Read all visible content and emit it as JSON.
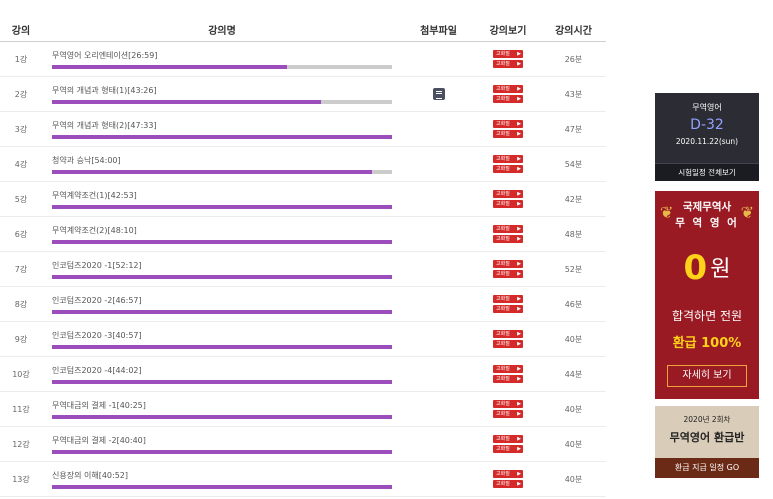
{
  "table": {
    "headers": {
      "no": "강의",
      "title": "강의명",
      "file": "첨부파일",
      "view": "강의보기",
      "time": "강의시간"
    },
    "view_button_label": "고화질",
    "rows": [
      {
        "no": "1강",
        "title": "무역영어 오리엔테이션[26:59]",
        "progress": 0.69,
        "has_file": false,
        "time": "26분"
      },
      {
        "no": "2강",
        "title": "무역의 개념과 형태(1)[43:26]",
        "progress": 0.79,
        "has_file": true,
        "time": "43분"
      },
      {
        "no": "3강",
        "title": "무역의 개념과 형태(2)[47:33]",
        "progress": 1.0,
        "has_file": false,
        "time": "47분"
      },
      {
        "no": "4강",
        "title": "청약과 승낙[54:00]",
        "progress": 0.94,
        "has_file": false,
        "time": "54분"
      },
      {
        "no": "5강",
        "title": "무역계약조건(1)[42:53]",
        "progress": 1.0,
        "has_file": false,
        "time": "42분"
      },
      {
        "no": "6강",
        "title": "무역계약조건(2)[48:10]",
        "progress": 1.0,
        "has_file": false,
        "time": "48분"
      },
      {
        "no": "7강",
        "title": "인코텀즈2020 -1[52:12]",
        "progress": 1.0,
        "has_file": false,
        "time": "52분"
      },
      {
        "no": "8강",
        "title": "인코텀즈2020 -2[46:57]",
        "progress": 1.0,
        "has_file": false,
        "time": "46분"
      },
      {
        "no": "9강",
        "title": "인코텀즈2020 -3[40:57]",
        "progress": 1.0,
        "has_file": false,
        "time": "40분"
      },
      {
        "no": "10강",
        "title": "인코텀즈2020 -4[44:02]",
        "progress": 1.0,
        "has_file": false,
        "time": "44분"
      },
      {
        "no": "11강",
        "title": "무역대금의 결제 -1[40:25]",
        "progress": 1.0,
        "has_file": false,
        "time": "40분"
      },
      {
        "no": "12강",
        "title": "무역대금의 결제 -2[40:40]",
        "progress": 1.0,
        "has_file": false,
        "time": "40분"
      },
      {
        "no": "13강",
        "title": "신용장의 이해[40:52]",
        "progress": 1.0,
        "has_file": false,
        "time": "40분"
      }
    ]
  },
  "dday_widget": {
    "category": "무역영어",
    "countdown": "D-32",
    "exam_date": "2020.11.22(sun)",
    "schedule_link": "시험일정 전체보기"
  },
  "promo_banner": {
    "line1": "국제무역사",
    "line2": "무 역 영 어",
    "price_number": "0",
    "price_unit": "원",
    "message": "합격하면 전원",
    "refund": "환급 100%",
    "detail_button": "자세히 보기"
  },
  "refund_banner": {
    "session": "2020년 2회차",
    "title": "무역영어 환급반",
    "go_link": "환급 지급 일정 GO"
  },
  "colors": {
    "progress_fill": "#9b4dbb",
    "progress_track": "#cccccc",
    "view_button": "#d42a2a",
    "promo_bg": "#9a1a24",
    "accent_yellow": "#ffd21a"
  }
}
